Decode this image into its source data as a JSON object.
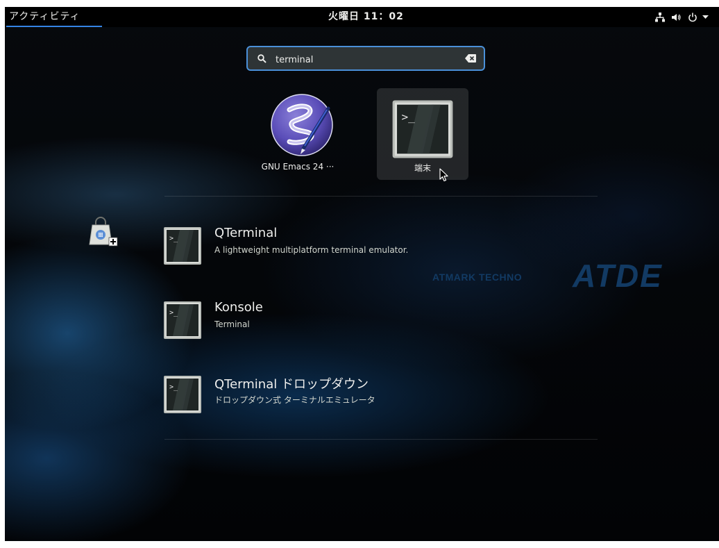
{
  "topbar": {
    "activities_label": "アクティビティ",
    "clock": "火曜日 11：02",
    "status_icons": [
      "network-icon",
      "volume-icon",
      "power-icon",
      "chevron-down-icon"
    ]
  },
  "search": {
    "value": "terminal",
    "icon": "search-icon",
    "clear_icon": "clear-icon"
  },
  "app_grid": [
    {
      "label": "GNU Emacs 24 ···",
      "icon": "emacs-icon"
    },
    {
      "label": "端末",
      "icon": "terminal-icon",
      "selected": true
    }
  ],
  "provider": {
    "icon": "software-center-icon"
  },
  "results": [
    {
      "title": "QTerminal",
      "description": "A lightweight multiplatform terminal emulator.",
      "icon": "terminal-icon"
    },
    {
      "title": "Konsole",
      "description": "Terminal",
      "icon": "terminal-icon"
    },
    {
      "title": "QTerminal ドロップダウン",
      "description": "ドロップダウン式 ターミナルエミュレータ",
      "icon": "terminal-icon"
    }
  ],
  "watermark": {
    "company": "ATMARK TECHNO",
    "product": "ATDE"
  },
  "colors": {
    "accent": "#3584e4",
    "search_border": "#4a90d9",
    "watermark": "#123a63"
  }
}
